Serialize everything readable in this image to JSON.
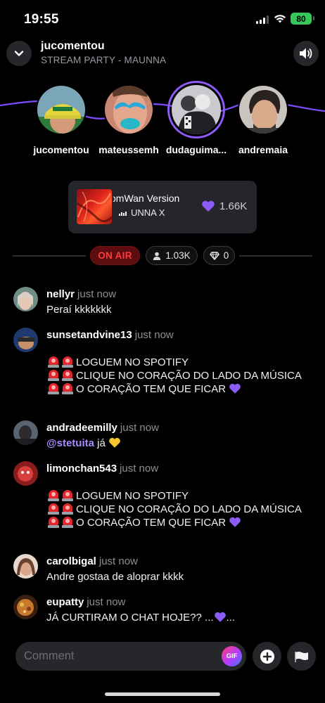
{
  "status_bar": {
    "time": "19:55",
    "battery": "80"
  },
  "header": {
    "title": "jucomentou",
    "subtitle": "STREAM PARTY - MAUNNA"
  },
  "participants": [
    {
      "name": "jucomentou",
      "active": false
    },
    {
      "name": "mateussemh",
      "active": false
    },
    {
      "name": "dudaguima...",
      "active": true
    },
    {
      "name": "andremaia",
      "active": false
    }
  ],
  "now_playing": {
    "title": "omWan Version",
    "artist": "UNNA X",
    "likes": "1.66K"
  },
  "live": {
    "on_air": "ON AIR",
    "listeners": "1.03K",
    "gems": "0"
  },
  "chat": [
    {
      "user": "nellyr",
      "time": "just now",
      "text": "Peraí kkkkkkk"
    },
    {
      "user": "sunsetandvine13",
      "time": "just now",
      "lines": [
        "LOGUEM NO SPOTIFY",
        "CLIQUE NO CORAÇÃO DO LADO DA MÚSICA",
        "O CORAÇÃO TEM QUE FICAR"
      ]
    },
    {
      "user": "andradeemilly",
      "time": "just now",
      "mention": "@stetuita",
      "text": "já"
    },
    {
      "user": "limonchan543",
      "time": "just now",
      "lines": [
        "LOGUEM NO SPOTIFY",
        "CLIQUE NO CORAÇÃO DO LADO DA MÚSICA",
        "O CORAÇÃO TEM QUE FICAR"
      ]
    },
    {
      "user": "carolbigal",
      "time": "just now",
      "text": "Andre gostaa de aloprar kkkk"
    },
    {
      "user": "eupatty",
      "time": "just now",
      "text": "JÁ CURTIRAM O CHAT HOJE?? ...",
      "text_after": "..."
    }
  ],
  "composer": {
    "placeholder": "Comment",
    "gif_label": "GIF"
  },
  "colors": {
    "accent": "#8b5cf6",
    "on_air": "#ff3b3b",
    "heart": "#8b5cf6"
  },
  "icons": [
    "chevron-down-icon",
    "speaker-icon",
    "heart-icon",
    "person-icon",
    "diamond-icon",
    "plus-icon",
    "flag-icon",
    "siren-icon"
  ]
}
